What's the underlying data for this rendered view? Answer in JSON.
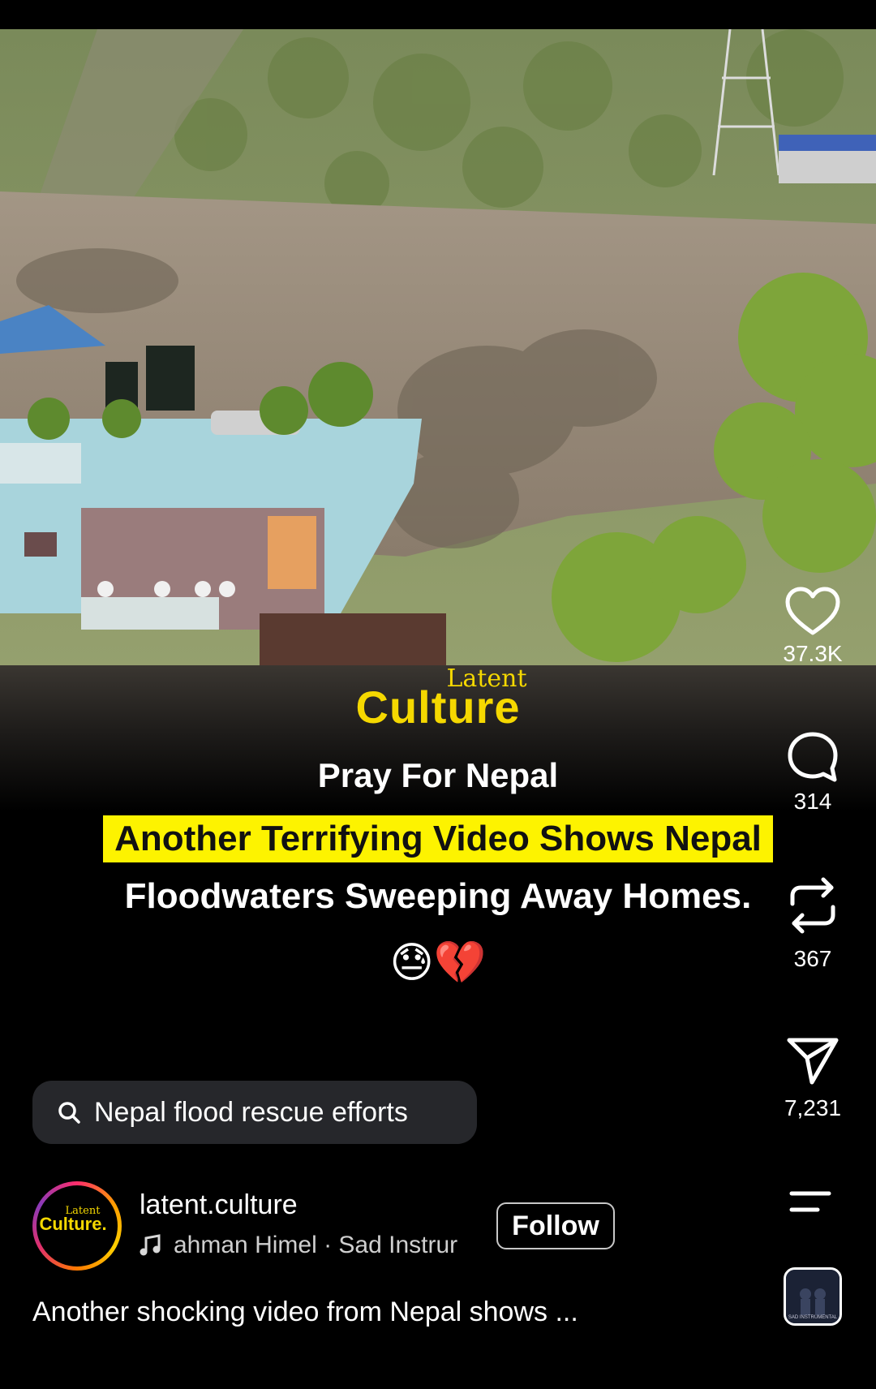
{
  "video": {
    "brand_small": "Latent",
    "brand_big": "Culture",
    "headline_line1": "Pray For Nepal",
    "headline_line2": "Another Terrifying Video Shows Nepal",
    "headline_line3": "Floodwaters Sweeping Away Homes.",
    "emojis": "😓💔"
  },
  "actions": {
    "likes": "37.3K",
    "comments": "314",
    "reposts": "367",
    "shares": "7,231"
  },
  "search_chip": {
    "label": "Nepal flood rescue efforts"
  },
  "account": {
    "avatar_small": "Latent",
    "avatar_big": "Culture.",
    "username": "latent.culture",
    "audio": "ahman Himel · Sad Instrur",
    "follow_label": "Follow"
  },
  "caption": "Another shocking video from Nepal shows ...",
  "audio_thumb_caption": "SAD INSTRUMENTAL",
  "icons": [
    "heart-icon",
    "comment-icon",
    "repost-icon",
    "share-icon",
    "search-icon",
    "music-note-icon",
    "menu-icon"
  ],
  "colors": {
    "brand_yellow": "#f5d800",
    "highlight": "#fdf300",
    "chip_bg": "#26272b"
  }
}
